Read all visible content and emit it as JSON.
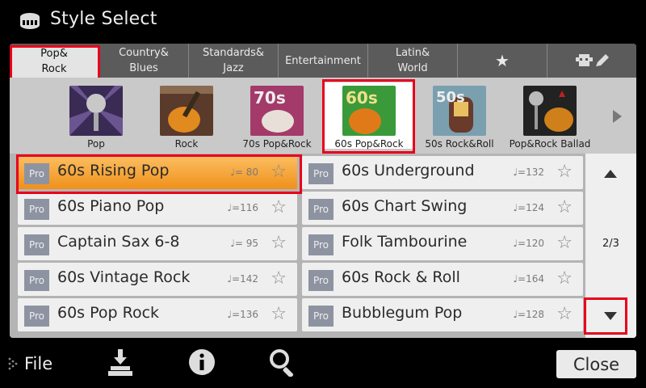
{
  "header": {
    "title": "Style Select",
    "icon": "keyboard-icon"
  },
  "tabs": [
    {
      "label": "Pop&\nRock",
      "selected": true
    },
    {
      "label": "Country&\nBlues"
    },
    {
      "label": "Standards&\nJazz"
    },
    {
      "label": "Entertainment"
    },
    {
      "label": "Latin&\nWorld"
    },
    {
      "label": "★",
      "icon": "favorite-star-icon"
    },
    {
      "label": "",
      "icon": "user-edit-icon"
    }
  ],
  "categories": [
    {
      "label": "Pop"
    },
    {
      "label": "Rock"
    },
    {
      "label": "70s Pop&Rock",
      "badge": "70s"
    },
    {
      "label": "60s Pop&Rock",
      "badge": "60s",
      "selected": true
    },
    {
      "label": "50s Rock&Roll",
      "badge": "50s"
    },
    {
      "label": "Pop&Rock Ballad"
    }
  ],
  "styles": [
    {
      "name": "60s Rising Pop",
      "tempo": "♩= 80",
      "pro": "Pro",
      "selected": true
    },
    {
      "name": "60s Underground",
      "tempo": "♩=132",
      "pro": "Pro"
    },
    {
      "name": "60s Piano Pop",
      "tempo": "♩=116",
      "pro": "Pro"
    },
    {
      "name": "60s Chart Swing",
      "tempo": "♩=124",
      "pro": "Pro"
    },
    {
      "name": "Captain Sax 6-8",
      "tempo": "♩= 95",
      "pro": "Pro"
    },
    {
      "name": "Folk Tambourine",
      "tempo": "♩=120",
      "pro": "Pro"
    },
    {
      "name": "60s Vintage Rock",
      "tempo": "♩=142",
      "pro": "Pro"
    },
    {
      "name": "60s Rock & Roll",
      "tempo": "♩=164",
      "pro": "Pro"
    },
    {
      "name": "60s Pop Rock",
      "tempo": "♩=136",
      "pro": "Pro"
    },
    {
      "name": "Bubblegum Pop",
      "tempo": "♩=128",
      "pro": "Pro"
    }
  ],
  "pager": {
    "text": "2/3"
  },
  "footer": {
    "file_label": "File",
    "close_label": "Close"
  },
  "colors": {
    "highlight": "#e8001c",
    "selected_row": "#f0901a",
    "panel": "#d3d3d3"
  }
}
